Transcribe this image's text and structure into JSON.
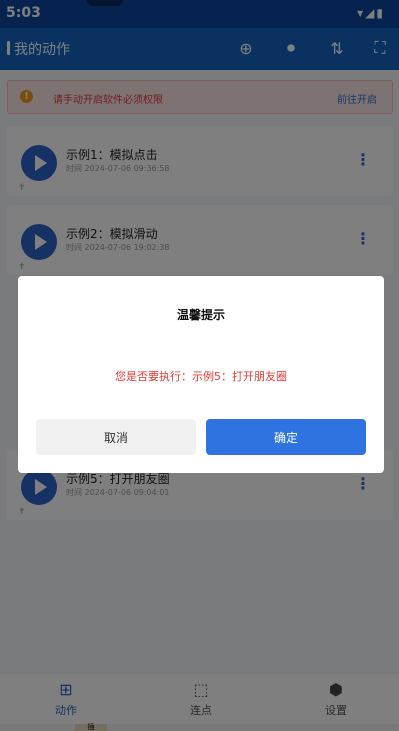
{
  "status_bar": {
    "time": "5:03",
    "icons": "▾◢▮"
  },
  "app_bar": {
    "title": "我的动作",
    "tools": [
      {
        "icon": "add-circle-icon",
        "glyph": "⊕"
      },
      {
        "icon": "record-video-icon",
        "glyph": "⏺"
      },
      {
        "icon": "sort-icon",
        "glyph": "⇅"
      },
      {
        "icon": "fullscreen-icon",
        "glyph": "⛶"
      }
    ]
  },
  "banner": {
    "message": "请手动开启软件必须权限",
    "action": "前往开启",
    "warn_glyph": "!"
  },
  "cards": [
    {
      "name": "示例1：模拟点击",
      "time": "时间 2024-07-06 09:36:58",
      "more": "⋮",
      "pin": "✝"
    },
    {
      "name": "示例2：模拟滑动",
      "time": "时间 2024-07-06 19:02:38",
      "more": "⋮",
      "pin": "✝"
    },
    {
      "name": "示例5：打开朋友圈",
      "time": "时间 2024-07-06 09:04:01",
      "more": "⋮",
      "pin": "✝"
    }
  ],
  "tabs": [
    {
      "label": "动作",
      "icon": "grid-icon",
      "glyph": "⊞",
      "active": true
    },
    {
      "label": "连点",
      "icon": "cursor-icon",
      "glyph": "⬚",
      "active": false
    },
    {
      "label": "设置",
      "icon": "settings-icon",
      "glyph": "⬢",
      "active": false
    }
  ],
  "dialog": {
    "title": "温馨提示",
    "message": "您是否要执行：示例5：打开朋友圈",
    "cancel": "取消",
    "confirm": "确定"
  },
  "nav_chip": "插",
  "colors": {
    "primary": "#1565c0",
    "accent": "#2f73e0",
    "warning_text": "#e53935"
  }
}
